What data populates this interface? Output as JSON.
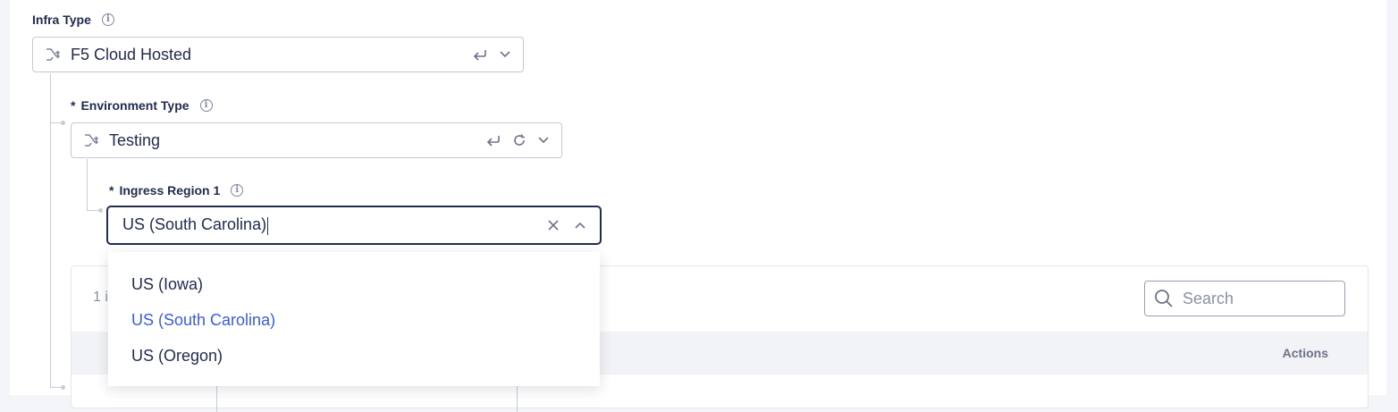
{
  "infra_type": {
    "label": "Infra Type",
    "value": "F5 Cloud Hosted"
  },
  "environment_type": {
    "required_mark": "*",
    "label": "Environment Type",
    "value": "Testing"
  },
  "ingress_region": {
    "required_mark": "*",
    "label": "Ingress Region 1",
    "value": "US (South Carolina)"
  },
  "dropdown": {
    "options": [
      {
        "label": "US (Iowa)",
        "selected": false
      },
      {
        "label": "US (South Carolina)",
        "selected": true
      },
      {
        "label": "US (Oregon)",
        "selected": false
      }
    ]
  },
  "table": {
    "items_count_text": "1 i",
    "search_placeholder": "Search",
    "actions_header": "Actions"
  },
  "colors": {
    "text": "#222c4d",
    "border": "#c4c8d4",
    "selected_option": "#3b5bdb",
    "muted": "#8a90a6"
  }
}
